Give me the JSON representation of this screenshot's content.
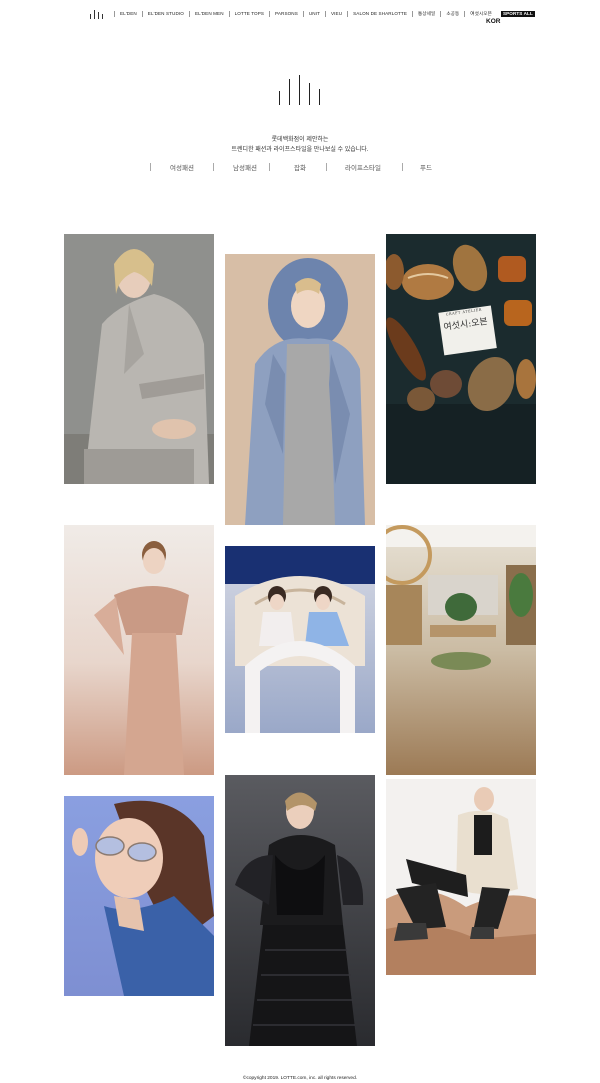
{
  "topnav": {
    "items": [
      "EL'DEN",
      "EL'DEN STUDIO",
      "EL'DEN MEN",
      "LOTTE TOPS",
      "PARSONS",
      "UNIT",
      "VIEU",
      "SALON DE SHARLOTTE",
      "통상세일",
      "소공동",
      "여섯시오븐"
    ],
    "special": "SPORTS ALL",
    "lang": "KOR"
  },
  "hero": {
    "line1": "롯데백화점이 제안하는",
    "line2": "트렌디한 패션과 라이프스타일을 만나보실 수 있습니다."
  },
  "categories": [
    "여성패션",
    "남성패션",
    "잡화",
    "라이프스타일",
    "푸드"
  ],
  "tiles": {
    "bakery_sign_en": "CRAFT ATELIER",
    "bakery_sign_ko": "여섯시:오븐"
  },
  "footer": "©copyright 2019. LOTTE.com, inc. all rights reserved.",
  "colors": {
    "background": "#ffffff",
    "text": "#222222"
  }
}
